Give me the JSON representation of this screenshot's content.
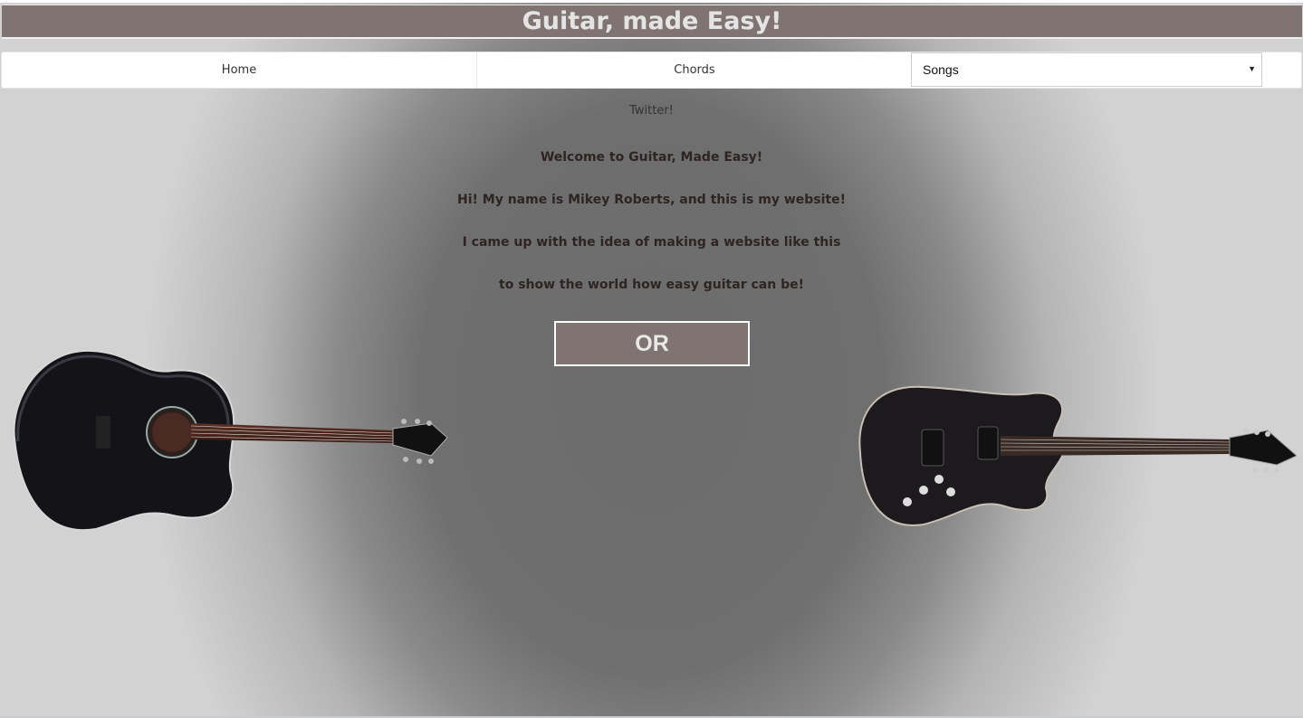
{
  "header": {
    "title": "Guitar, made Easy!"
  },
  "nav": {
    "home_label": "Home",
    "chords_label": "Chords",
    "songs_select_value": "Songs"
  },
  "content": {
    "twitter_link": "Twitter!",
    "lines": [
      "Welcome to Guitar, Made Easy!",
      "Hi! My name is Mikey Roberts, and this is my website!",
      "I came up with the idea of making a website like this",
      "to show the world how easy guitar can be!"
    ],
    "or_button_label": "OR"
  },
  "colors": {
    "title_bar": "#807473",
    "title_text": "#e4e4e4",
    "body_text": "#2e2424"
  },
  "images": {
    "left": "acoustic-guitar",
    "right": "electric-guitar"
  }
}
